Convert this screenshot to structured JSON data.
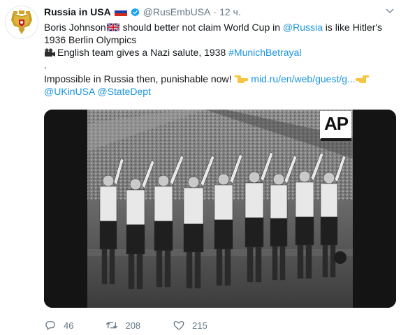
{
  "tweet": {
    "author_name": "Russia in USA",
    "handle": "@RusEmbUSA",
    "separator": "·",
    "time": "12 ч.",
    "text": {
      "line1_mention": "Boris Johnson",
      "line1_mid": " should better not claim World Cup in ",
      "line1_mention2": "@Russia",
      "line1_end": " is like Hitler's",
      "line2": "1936 Berlin Olympics",
      "line3_text": "English team gives a Nazi salute, 1938 ",
      "line3_hashtag": "#MunichBetrayal",
      "line4": ".",
      "line5_text": "Impossible in Russia then, punishable now! ",
      "line5_link": "mid.ru/en/web/guest/g...",
      "line6_mention1": "@UKinUSA",
      "line6_mention2": "@StateDept"
    },
    "media": {
      "watermark": "AP"
    },
    "actions": {
      "replies": "46",
      "retweets": "208",
      "likes": "215"
    },
    "colors": {
      "link": "#1b95e0",
      "muted": "#657786",
      "verified": "#1da1f2"
    },
    "icons": [
      "russian-coat-of-arms-avatar",
      "russia-flag-icon",
      "verified-badge-icon",
      "chevron-down-icon",
      "uk-flag-icon",
      "movie-camera-icon",
      "pointing-hand-icon",
      "reply-icon",
      "retweet-icon",
      "like-icon"
    ]
  }
}
